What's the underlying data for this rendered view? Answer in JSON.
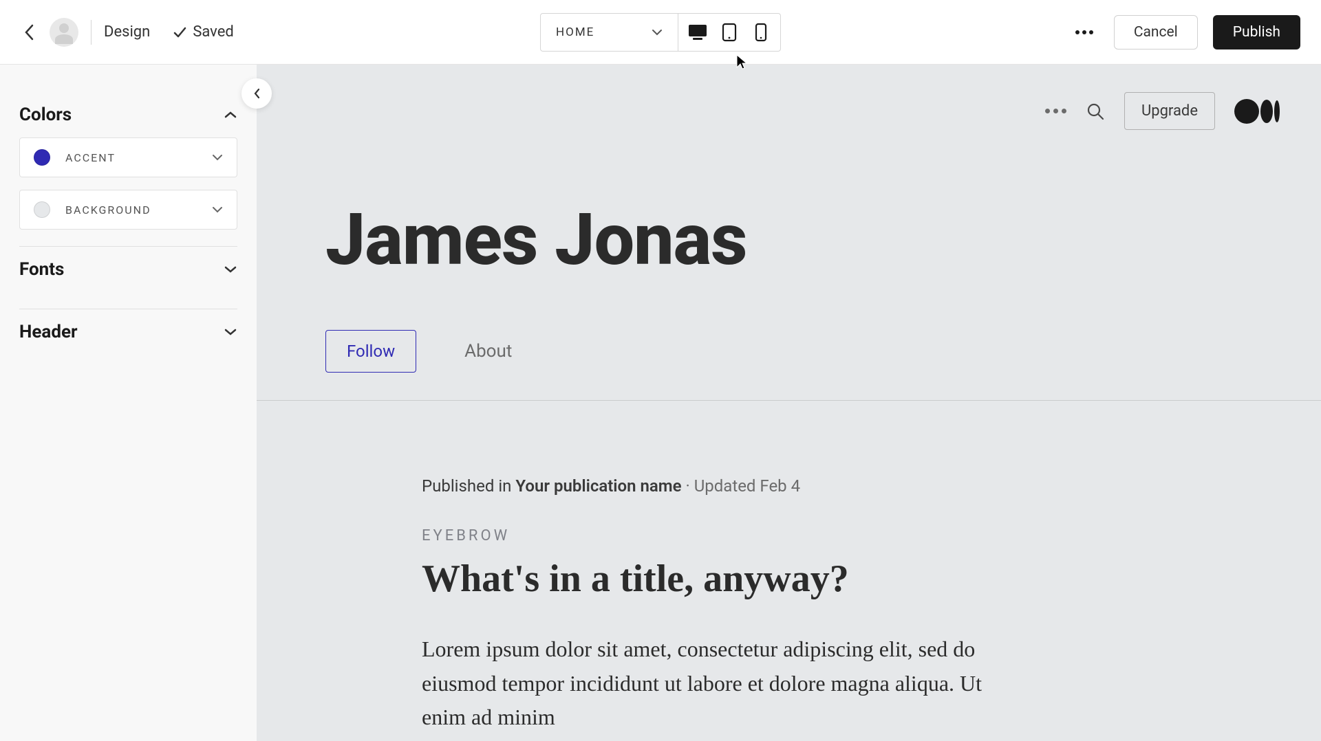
{
  "topbar": {
    "design_label": "Design",
    "saved_label": "Saved",
    "page_selector": "HOME",
    "cancel_label": "Cancel",
    "publish_label": "Publish"
  },
  "sidebar": {
    "sections": {
      "colors": {
        "title": "Colors",
        "expanded": true
      },
      "fonts": {
        "title": "Fonts",
        "expanded": false
      },
      "header": {
        "title": "Header",
        "expanded": false
      }
    },
    "colors": {
      "accent": {
        "label": "ACCENT",
        "value": "#2f2ab3"
      },
      "background": {
        "label": "BACKGROUND",
        "value": "#e6e8ea"
      }
    }
  },
  "preview": {
    "upgrade_label": "Upgrade",
    "site_title": "James Jonas",
    "follow_label": "Follow",
    "about_label": "About",
    "article": {
      "published_prefix": "Published in ",
      "publication_name": "Your publication name",
      "updated_text": " · Updated Feb 4",
      "eyebrow": "EYEBROW",
      "title": "What's in a title, anyway?",
      "body": "Lorem ipsum dolor sit amet, consectetur adipiscing elit, sed do eiusmod tempor incididunt ut labore et dolore magna aliqua. Ut enim ad minim"
    }
  }
}
